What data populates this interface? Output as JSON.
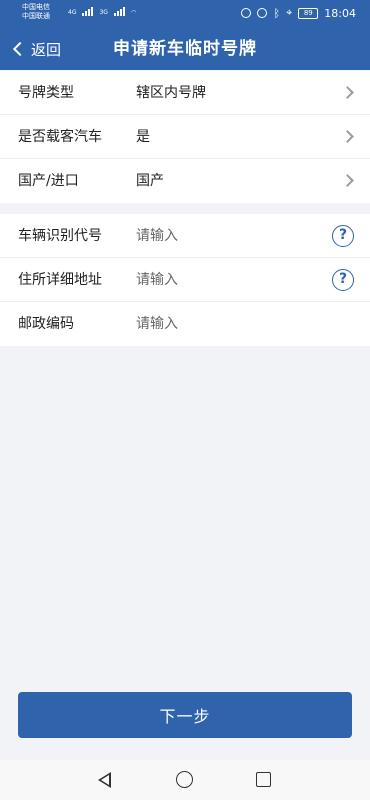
{
  "status_bar": {
    "carrier1": "中国电信",
    "carrier2": "中国联通",
    "net1": "4G",
    "net2": "3G",
    "battery": "89",
    "time": "18:04"
  },
  "header": {
    "back_label": "返回",
    "title": "申请新车临时号牌"
  },
  "form": {
    "select_rows": [
      {
        "label": "号牌类型",
        "value": "辖区内号牌"
      },
      {
        "label": "是否载客汽车",
        "value": "是"
      },
      {
        "label": "国产/进口",
        "value": "国产"
      }
    ],
    "input_rows": [
      {
        "label": "车辆识别代号",
        "placeholder": "请输入",
        "help": "?"
      },
      {
        "label": "住所详细地址",
        "placeholder": "请输入",
        "help": "?"
      },
      {
        "label": "邮政编码",
        "placeholder": "请输入"
      }
    ]
  },
  "next_button_label": "下一步",
  "icons": {
    "back": "chevron-left-icon",
    "row_arrow": "chevron-right-icon",
    "help": "question-circle-icon"
  },
  "colors": {
    "brand": "#2f63ac",
    "page_bg": "#f2f3f7"
  }
}
